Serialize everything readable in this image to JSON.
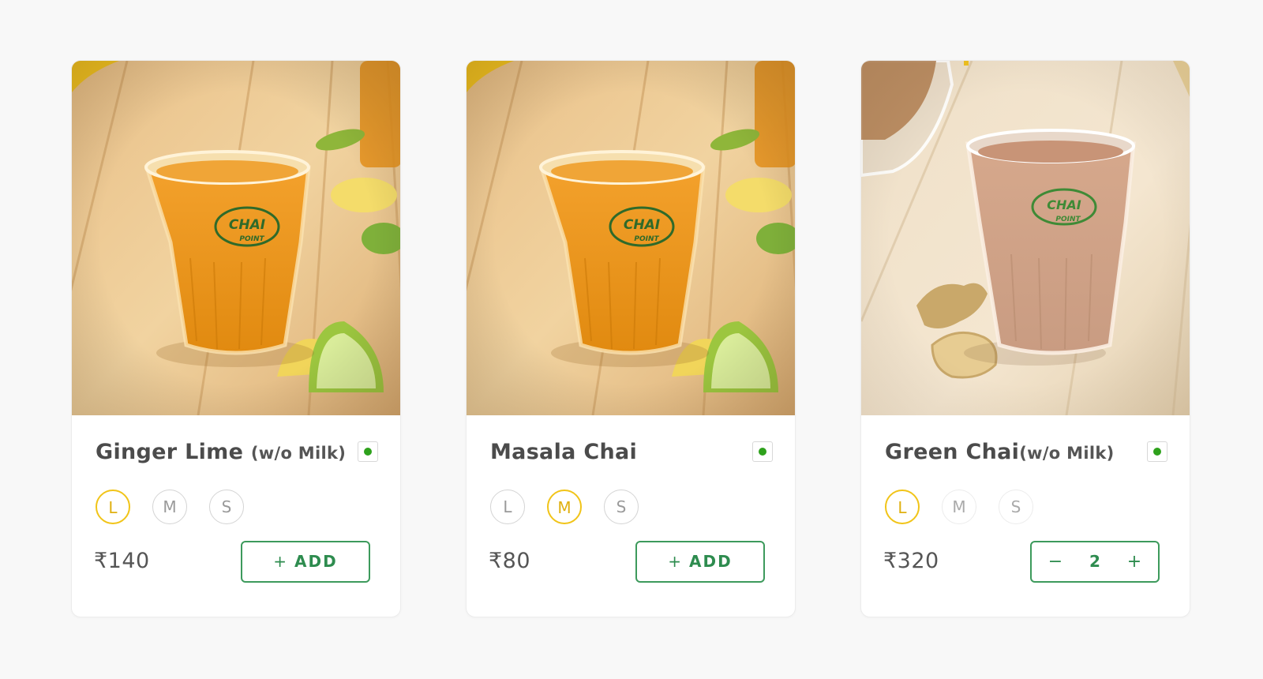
{
  "products": [
    {
      "name": "Ginger Lime",
      "subtitle": "(w/o Milk)",
      "sizes": [
        "L",
        "M",
        "S"
      ],
      "selected_size": "L",
      "price": "₹140",
      "action": {
        "type": "add",
        "label": "ADD",
        "plus": "+"
      },
      "veg_color": "#2ea11c",
      "image_icon": "lime-tea-photo"
    },
    {
      "name": "Masala Chai",
      "subtitle": "",
      "sizes": [
        "L",
        "M",
        "S"
      ],
      "selected_size": "M",
      "price": "₹80",
      "action": {
        "type": "add",
        "label": "ADD",
        "plus": "+"
      },
      "veg_color": "#2ea11c",
      "image_icon": "lime-tea-photo"
    },
    {
      "name": "Green Chai",
      "subtitle": "(w/o Milk)",
      "sizes": [
        "L",
        "M",
        "S"
      ],
      "selected_size": "L",
      "price": "₹320",
      "action": {
        "type": "stepper",
        "minus": "−",
        "quantity": "2",
        "plus": "+"
      },
      "veg_color": "#2ea11c",
      "image_icon": "milk-chai-photo"
    }
  ],
  "image_text": {
    "logo_line1": "CHAI",
    "logo_line2": "POINT"
  },
  "colors": {
    "accent_green": "#3d9a5c",
    "selected_size": "#f1c418",
    "veg_dot": "#2ea11c"
  }
}
